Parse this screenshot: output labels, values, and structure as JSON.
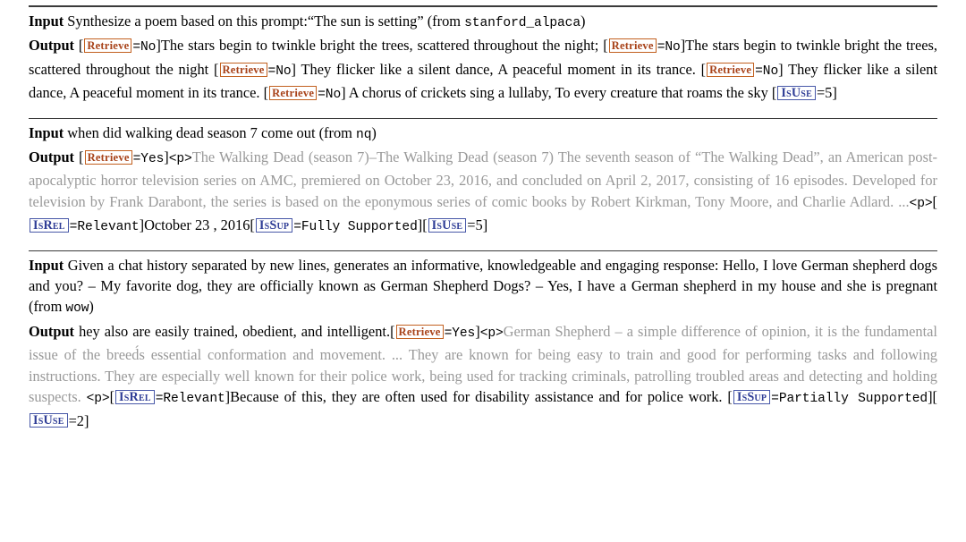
{
  "document": {
    "type": "examples-table",
    "labels": {
      "input": "Input",
      "output": "Output"
    },
    "token_colors": {
      "retrieve_border": "#c2601f",
      "retrieve_text": "#a8431a",
      "critic_border": "#4858a8",
      "critic_text": "#2f3d96",
      "passage_gray": "#999999"
    },
    "tokens": {
      "retrieve": "Retrieve",
      "isrel": "IsRel",
      "issup": "IsSup",
      "isuse": "IsUse"
    }
  },
  "examples": [
    {
      "id": "example-1",
      "input": {
        "label": "Input",
        "text": "Synthesize a poem based on this prompt:“The sun is setting” (from ",
        "source": "stanford_alpaca",
        "close": ")"
      },
      "output": {
        "label": "Output",
        "segments": [
          {
            "kind": "bracket",
            "text": "["
          },
          {
            "kind": "token",
            "token": "Retrieve",
            "style": "retrieve"
          },
          {
            "kind": "mono",
            "text": "=No"
          },
          {
            "kind": "bracket",
            "text": "]"
          },
          {
            "kind": "text",
            "text": "The stars begin to twinkle bright the trees, scattered throughout the night; "
          },
          {
            "kind": "bracket",
            "text": "["
          },
          {
            "kind": "token",
            "token": "Retrieve",
            "style": "retrieve"
          },
          {
            "kind": "mono",
            "text": "=No"
          },
          {
            "kind": "bracket",
            "text": "]"
          },
          {
            "kind": "text",
            "text": "The stars begin to twinkle bright the trees, scattered throughout the night "
          },
          {
            "kind": "bracket",
            "text": "["
          },
          {
            "kind": "token",
            "token": "Retrieve",
            "style": "retrieve"
          },
          {
            "kind": "mono",
            "text": "=No"
          },
          {
            "kind": "bracket",
            "text": "]"
          },
          {
            "kind": "text",
            "text": " They flicker like a silent dance, A peaceful moment in its trance. "
          },
          {
            "kind": "bracket",
            "text": "["
          },
          {
            "kind": "token",
            "token": "Retrieve",
            "style": "retrieve"
          },
          {
            "kind": "mono",
            "text": "=No"
          },
          {
            "kind": "bracket",
            "text": "]"
          },
          {
            "kind": "text",
            "text": " They flicker like a silent dance, A peaceful moment in its trance. "
          },
          {
            "kind": "bracket",
            "text": "["
          },
          {
            "kind": "token",
            "token": "Retrieve",
            "style": "retrieve"
          },
          {
            "kind": "mono",
            "text": "=No"
          },
          {
            "kind": "bracket",
            "text": "]"
          },
          {
            "kind": "text",
            "text": " A chorus of crickets sing a lullaby, To every creature that roams the sky "
          },
          {
            "kind": "bracket",
            "text": "["
          },
          {
            "kind": "token",
            "token": "IsUse",
            "style": "isuse"
          },
          {
            "kind": "text",
            "text": "=5"
          },
          {
            "kind": "bracket",
            "text": "]"
          }
        ]
      }
    },
    {
      "id": "example-2",
      "input": {
        "label": "Input",
        "text": "when did walking dead season 7 come out (from ",
        "source": "nq",
        "close": ")"
      },
      "output": {
        "label": "Output",
        "segments": [
          {
            "kind": "bracket",
            "text": "["
          },
          {
            "kind": "token",
            "token": "Retrieve",
            "style": "retrieve"
          },
          {
            "kind": "mono",
            "text": "=Yes"
          },
          {
            "kind": "bracket",
            "text": "]"
          },
          {
            "kind": "mono",
            "text": "<p>"
          },
          {
            "kind": "passage",
            "text": "The Walking Dead (season 7)–The Walking Dead (season 7) The seventh season of “The Walking Dead”, an American post-apocalyptic horror television series on AMC, premiered on October 23, 2016, and concluded on April 2, 2017, consisting of 16 episodes. Developed for television by Frank Darabont, the series is based on the eponymous series of comic books by Robert Kirkman, Tony Moore, and Charlie Adlard. ..."
          },
          {
            "kind": "mono",
            "text": "<p>"
          },
          {
            "kind": "bracket",
            "text": "["
          },
          {
            "kind": "token",
            "token": "IsRel",
            "style": "isrel"
          },
          {
            "kind": "mono",
            "text": "=Relevant"
          },
          {
            "kind": "bracket",
            "text": "]"
          },
          {
            "kind": "text",
            "text": "October 23 , 2016"
          },
          {
            "kind": "bracket",
            "text": "["
          },
          {
            "kind": "token",
            "token": "IsSup",
            "style": "issup"
          },
          {
            "kind": "mono",
            "text": "=Fully Supported"
          },
          {
            "kind": "bracket",
            "text": "]"
          },
          {
            "kind": "bracket",
            "text": "["
          },
          {
            "kind": "token",
            "token": "IsUse",
            "style": "isuse"
          },
          {
            "kind": "text",
            "text": "=5"
          },
          {
            "kind": "bracket",
            "text": "]"
          }
        ]
      }
    },
    {
      "id": "example-3",
      "input": {
        "label": "Input",
        "text": "Given a chat history separated by new lines, generates an informative, knowledgeable and engaging response: Hello, I love German shepherd dogs and you? – My favorite dog, they are officially known as German Shepherd Dogs? – Yes, I have a German shepherd in my house and she is pregnant (from ",
        "source": "wow",
        "close": ")"
      },
      "output": {
        "label": "Output",
        "segments": [
          {
            "kind": "text",
            "text": "hey also are easily trained, obedient, and intelligent."
          },
          {
            "kind": "bracket",
            "text": "["
          },
          {
            "kind": "token",
            "token": "Retrieve",
            "style": "retrieve"
          },
          {
            "kind": "mono",
            "text": "=Yes"
          },
          {
            "kind": "bracket",
            "text": "]"
          },
          {
            "kind": "mono",
            "text": "<p>"
          },
          {
            "kind": "passage",
            "text": "German Shepherd – a simple difference of opinion, it is the fundamental issue of the breed́s essential conformation and movement. ... They are known for being easy to train and good for performing tasks and following instructions. They are especially well known for their police work, being used for tracking criminals, patrolling troubled areas and detecting and holding suspects. "
          },
          {
            "kind": "mono",
            "text": "<p>"
          },
          {
            "kind": "bracket",
            "text": "["
          },
          {
            "kind": "token",
            "token": "IsRel",
            "style": "isrel"
          },
          {
            "kind": "mono",
            "text": "=Relevant"
          },
          {
            "kind": "bracket",
            "text": "]"
          },
          {
            "kind": "text",
            "text": "Because of this, they are often used for disability assistance and for police work. "
          },
          {
            "kind": "bracket",
            "text": "["
          },
          {
            "kind": "token",
            "token": "IsSup",
            "style": "issup"
          },
          {
            "kind": "mono",
            "text": "=Partially Supported"
          },
          {
            "kind": "bracket",
            "text": "]"
          },
          {
            "kind": "bracket",
            "text": "["
          },
          {
            "kind": "token",
            "token": "IsUse",
            "style": "isuse"
          },
          {
            "kind": "text",
            "text": "=2"
          },
          {
            "kind": "bracket",
            "text": "]"
          }
        ]
      }
    }
  ]
}
